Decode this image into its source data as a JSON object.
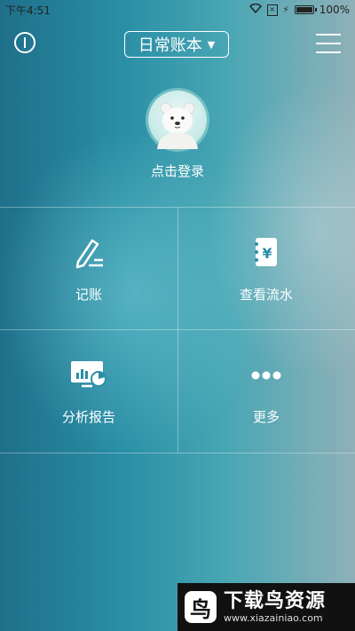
{
  "status_bar": {
    "time": "下午4:51",
    "battery": "100%"
  },
  "header": {
    "book_name": "日常账本",
    "info_icon": "info-icon",
    "menu_icon": "menu-icon"
  },
  "profile": {
    "login_text": "点击登录",
    "avatar_icon": "polar-bear-avatar"
  },
  "actions": [
    {
      "label": "记账",
      "icon": "pen-icon"
    },
    {
      "label": "查看流水",
      "icon": "ledger-yen-icon"
    },
    {
      "label": "分析报告",
      "icon": "chart-monitor-icon"
    },
    {
      "label": "更多",
      "icon": "more-dots-icon"
    }
  ],
  "watermark": {
    "logo_char": "鸟",
    "title": "下载鸟资源",
    "url": "www.xiazainiao.com"
  }
}
